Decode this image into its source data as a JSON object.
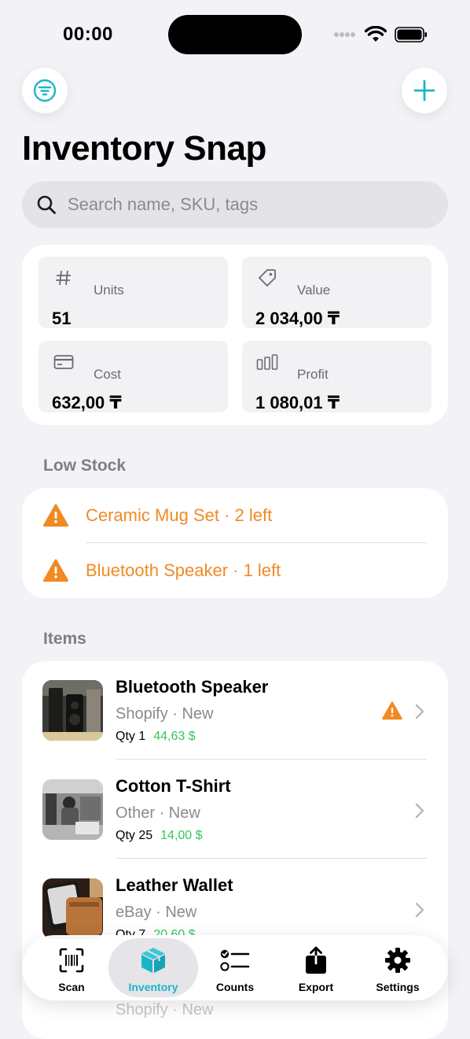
{
  "status_bar": {
    "time": "00:00"
  },
  "header": {
    "title": "Inventory Snap"
  },
  "search": {
    "placeholder": "Search name, SKU, tags"
  },
  "stats": [
    {
      "label": "Units",
      "value": "51",
      "icon": "hash-icon"
    },
    {
      "label": "Value",
      "value": "2 034,00 ₸",
      "icon": "tag-icon"
    },
    {
      "label": "Cost",
      "value": "632,00 ₸",
      "icon": "credit-card-icon"
    },
    {
      "label": "Profit",
      "value": "1 080,01 ₸",
      "icon": "bar-chart-icon"
    }
  ],
  "low_stock": {
    "heading": "Low Stock",
    "items": [
      {
        "text": "Ceramic Mug Set · 2 left"
      },
      {
        "text": "Bluetooth Speaker · 1 left"
      }
    ]
  },
  "items": {
    "heading": "Items",
    "list": [
      {
        "name": "Bluetooth Speaker",
        "source": "Shopify · New",
        "qty": "Qty 1",
        "price": "44,63 $",
        "warning": true
      },
      {
        "name": "Cotton T-Shirt",
        "source": "Other · New",
        "qty": "Qty 25",
        "price": "14,00 $",
        "warning": false
      },
      {
        "name": "Leather Wallet",
        "source": "eBay · New",
        "qty": "Qty 7",
        "price": "20,60 $",
        "warning": false
      },
      {
        "source": "Shopify · New"
      }
    ]
  },
  "tabbar": {
    "tabs": [
      {
        "label": "Scan",
        "icon": "barcode-scan-icon"
      },
      {
        "label": "Inventory",
        "icon": "box-icon",
        "active": true
      },
      {
        "label": "Counts",
        "icon": "checklist-icon"
      },
      {
        "label": "Export",
        "icon": "share-icon"
      },
      {
        "label": "Settings",
        "icon": "gear-icon"
      }
    ]
  },
  "colors": {
    "accent": "#1BB5C5",
    "warning": "#F08A24",
    "price": "#34C759",
    "background": "#F2F2F7"
  }
}
